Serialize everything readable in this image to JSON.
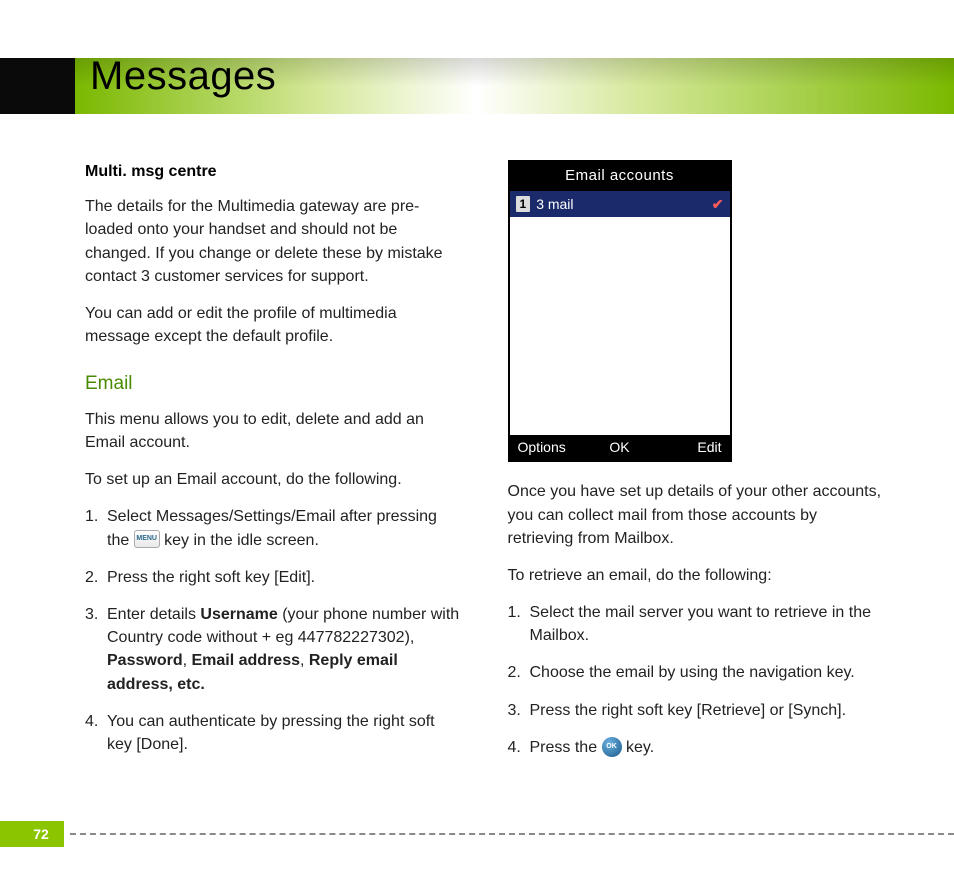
{
  "page": {
    "title": "Messages",
    "number": "72"
  },
  "left": {
    "heading1": "Multi. msg centre",
    "p1": "The details for the Multimedia gateway are pre-loaded onto your handset and should not be changed. If you change or delete these by mistake contact 3 customer services for support.",
    "p2": "You can add or edit the profile of multimedia message except the default profile.",
    "heading2": "Email",
    "p3": "This menu allows you to edit, delete and add an Email account.",
    "p4": "To set up an Email account, do the following.",
    "step1_a": "Select Messages/Settings/Email after pressing the ",
    "step1_b": " key in the idle screen.",
    "menu_key": "MENU",
    "step2": "Press the right soft key [Edit].",
    "step3_a": "Enter details ",
    "step3_b": "Username",
    "step3_c": " (your phone number with Country code without + eg 447782227302), ",
    "step3_d": "Password",
    "step3_e": ", ",
    "step3_f": "Email address",
    "step3_g": ", ",
    "step3_h": "Reply email address, etc.",
    "step4": "You can authenticate by pressing the right soft key [Done]."
  },
  "phone": {
    "title": "Email accounts",
    "row_num": "1",
    "row_label": "3 mail",
    "tick": "✔",
    "soft_left": "Options",
    "soft_center": "OK",
    "soft_right": "Edit"
  },
  "right": {
    "p1": "Once you have set up details of your other accounts, you can collect mail from those accounts by retrieving from Mailbox.",
    "p2": "To retrieve an email, do the following:",
    "step1": "Select the mail server you want to retrieve in the Mailbox.",
    "step2": "Choose the email by using the navigation key.",
    "step3": "Press the right soft key [Retrieve] or [Synch].",
    "step4_a": "Press the ",
    "step4_b": " key.",
    "ok_key": "OK"
  }
}
